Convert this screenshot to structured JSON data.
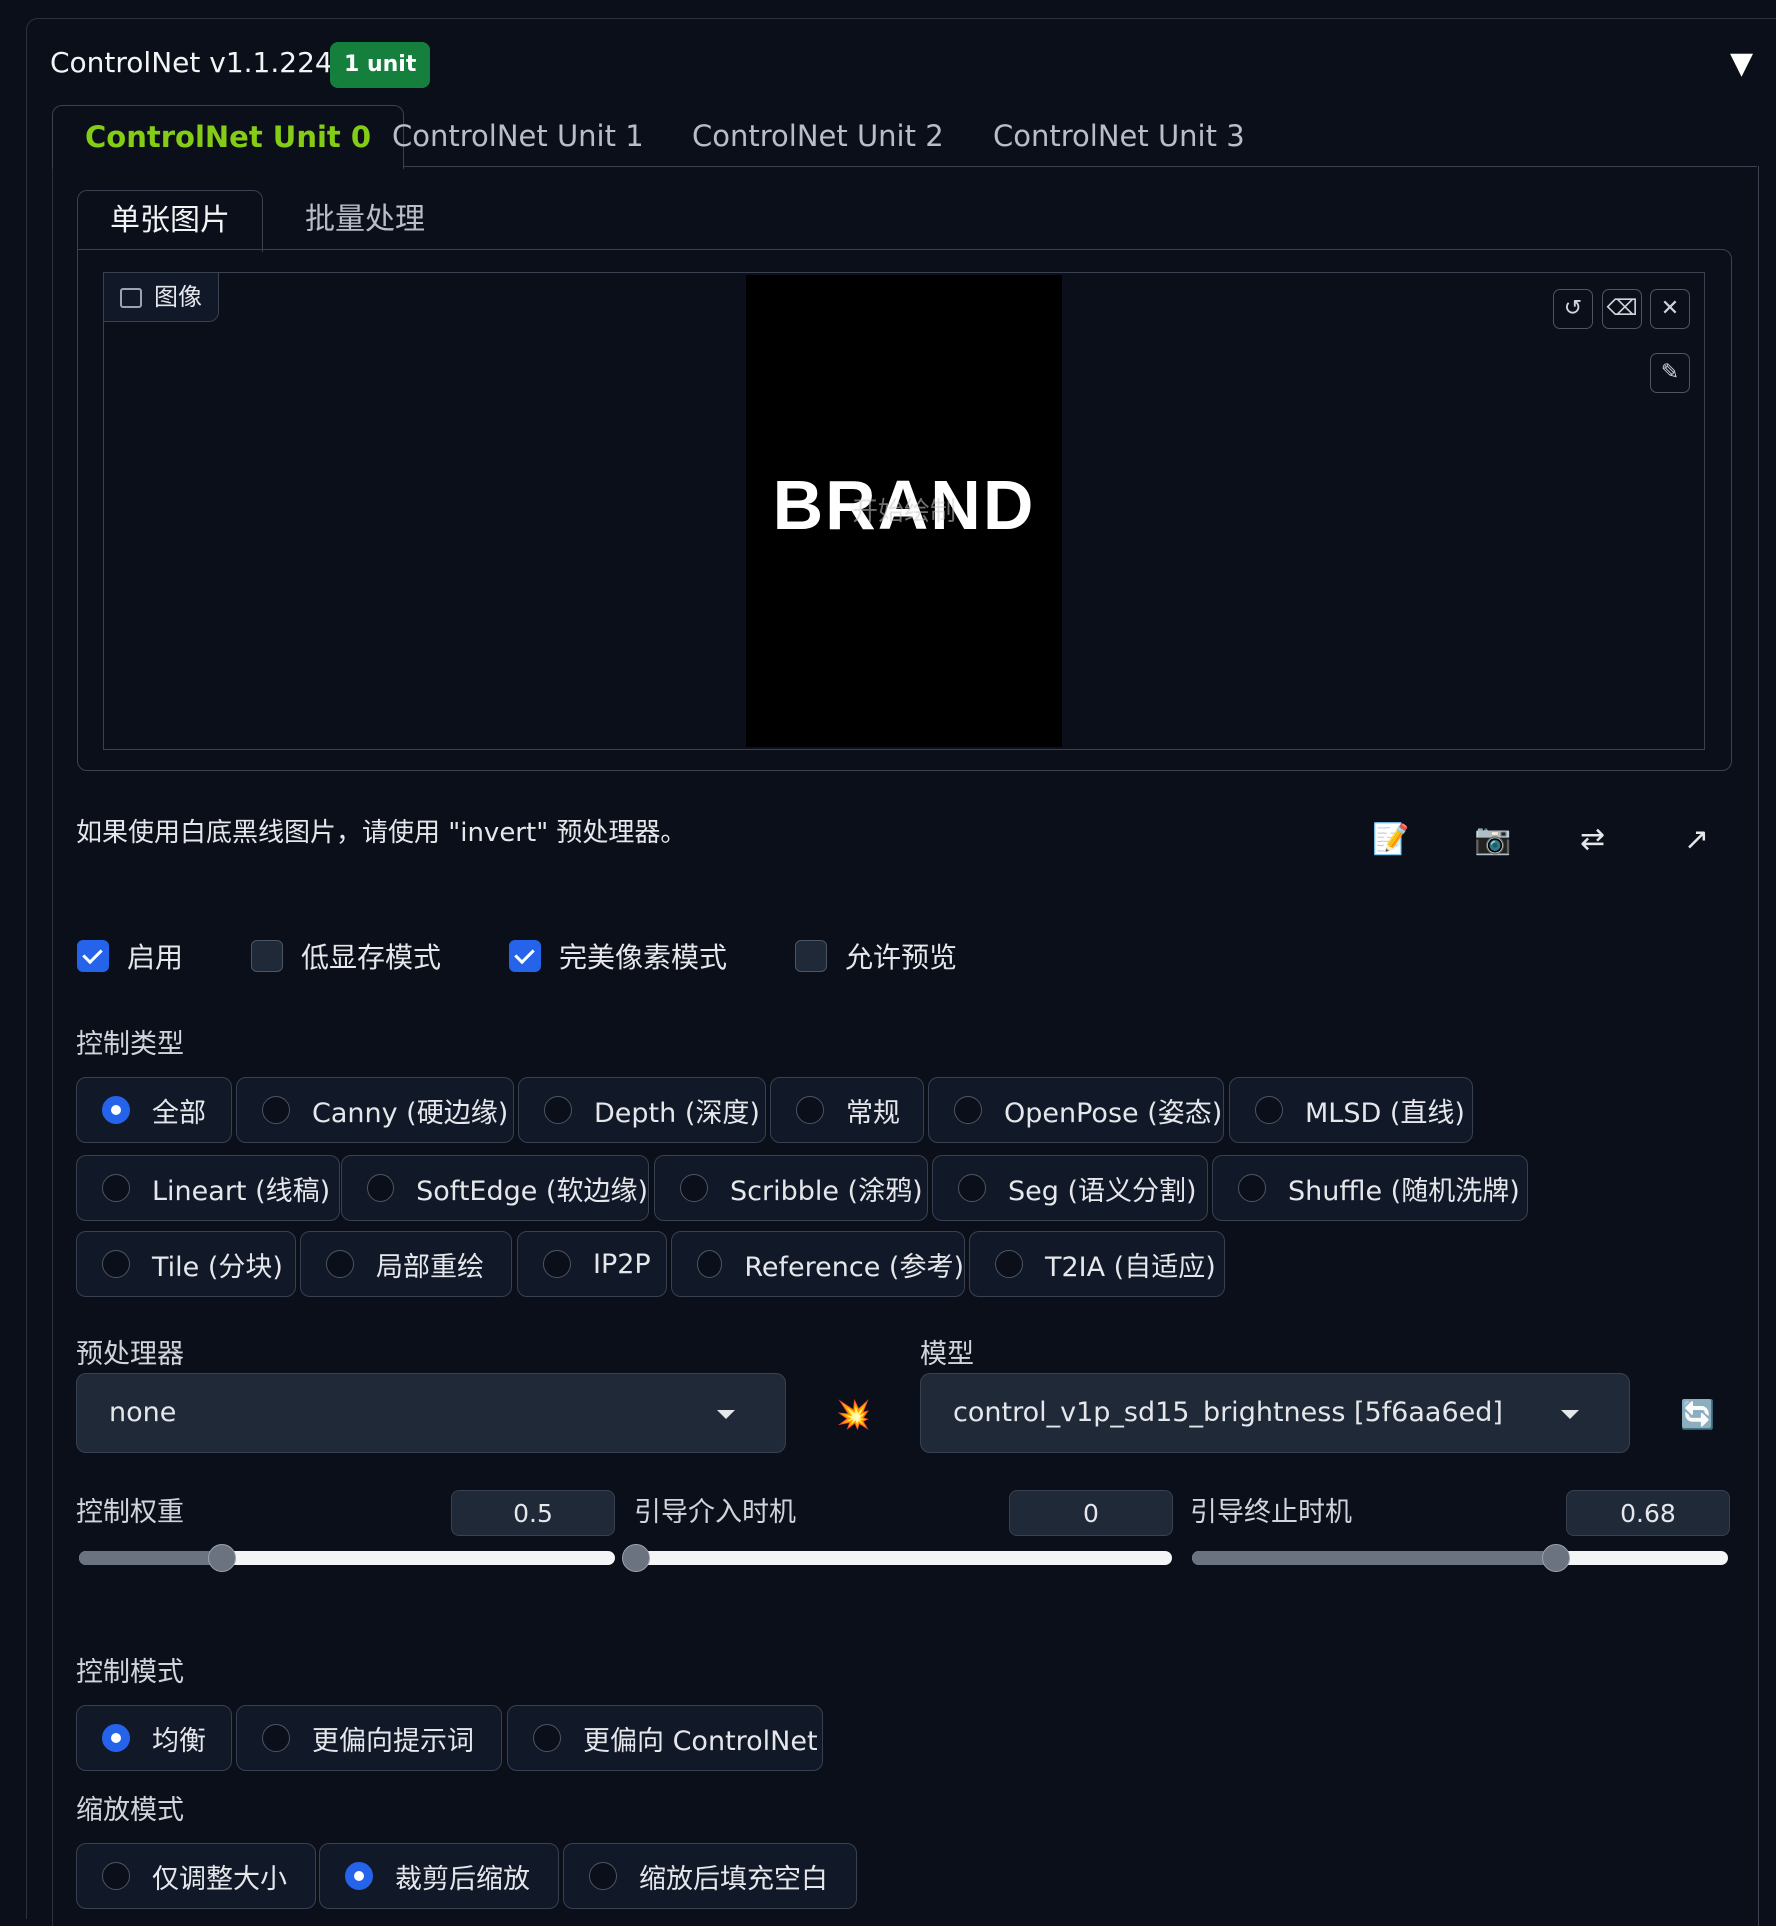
{
  "header": {
    "title": "ControlNet v1.1.224",
    "badge": "1 unit",
    "collapse_icon": "triangle-down-icon"
  },
  "unit_tabs": [
    "ControlNet Unit 0",
    "ControlNet Unit 1",
    "ControlNet Unit 2",
    "ControlNet Unit 3"
  ],
  "active_unit_tab": 0,
  "sub_tabs": [
    "单张图片",
    "批量处理"
  ],
  "image": {
    "label": "图像",
    "canvas_text": "BRAND",
    "overlay_hint": "开始绘制"
  },
  "note": "如果使用白底黑线图片，请使用 \"invert\" 预处理器。",
  "checkboxes": [
    {
      "label": "启用",
      "checked": true
    },
    {
      "label": "低显存模式",
      "checked": false
    },
    {
      "label": "完美像素模式",
      "checked": true
    },
    {
      "label": "允许预览",
      "checked": false
    }
  ],
  "control_type": {
    "label": "控制类型",
    "rows": [
      [
        "全部",
        "Canny (硬边缘)",
        "Depth (深度)",
        "常规",
        "OpenPose (姿态)",
        "MLSD (直线)"
      ],
      [
        "Lineart (线稿)",
        "SoftEdge (软边缘)",
        "Scribble (涂鸦)",
        "Seg (语义分割)",
        "Shuffle (随机洗牌)"
      ],
      [
        "Tile (分块)",
        "局部重绘",
        "IP2P",
        "Reference (参考)",
        "T2IA (自适应)"
      ]
    ],
    "selected": "全部"
  },
  "preprocessor": {
    "label": "预处理器",
    "value": "none"
  },
  "model": {
    "label": "模型",
    "value": "control_v1p_sd15_brightness [5f6aa6ed]"
  },
  "sliders": [
    {
      "label": "控制权重",
      "value": "0.5",
      "fraction": 0.2667
    },
    {
      "label": "引导介入时机",
      "value": "0",
      "fraction": 0.0
    },
    {
      "label": "引导终止时机",
      "value": "0.68",
      "fraction": 0.68
    }
  ],
  "control_mode": {
    "label": "控制模式",
    "options": [
      "均衡",
      "更偏向提示词",
      "更偏向 ControlNet"
    ],
    "selected": "均衡"
  },
  "resize_mode": {
    "label": "缩放模式",
    "options": [
      "仅调整大小",
      "裁剪后缩放",
      "缩放后填充空白"
    ],
    "selected": "裁剪后缩放"
  },
  "icons": {
    "reset": "↺",
    "erase": "⌫",
    "close": "✕",
    "brush": "✎",
    "edit": "📝",
    "camera": "📷",
    "swap": "⇄",
    "send": "↗",
    "preprocess": "💥",
    "refresh": "🔄"
  },
  "colors": {
    "accent": "#84cc16",
    "badge": "#15803d",
    "checked": "#2563eb"
  }
}
